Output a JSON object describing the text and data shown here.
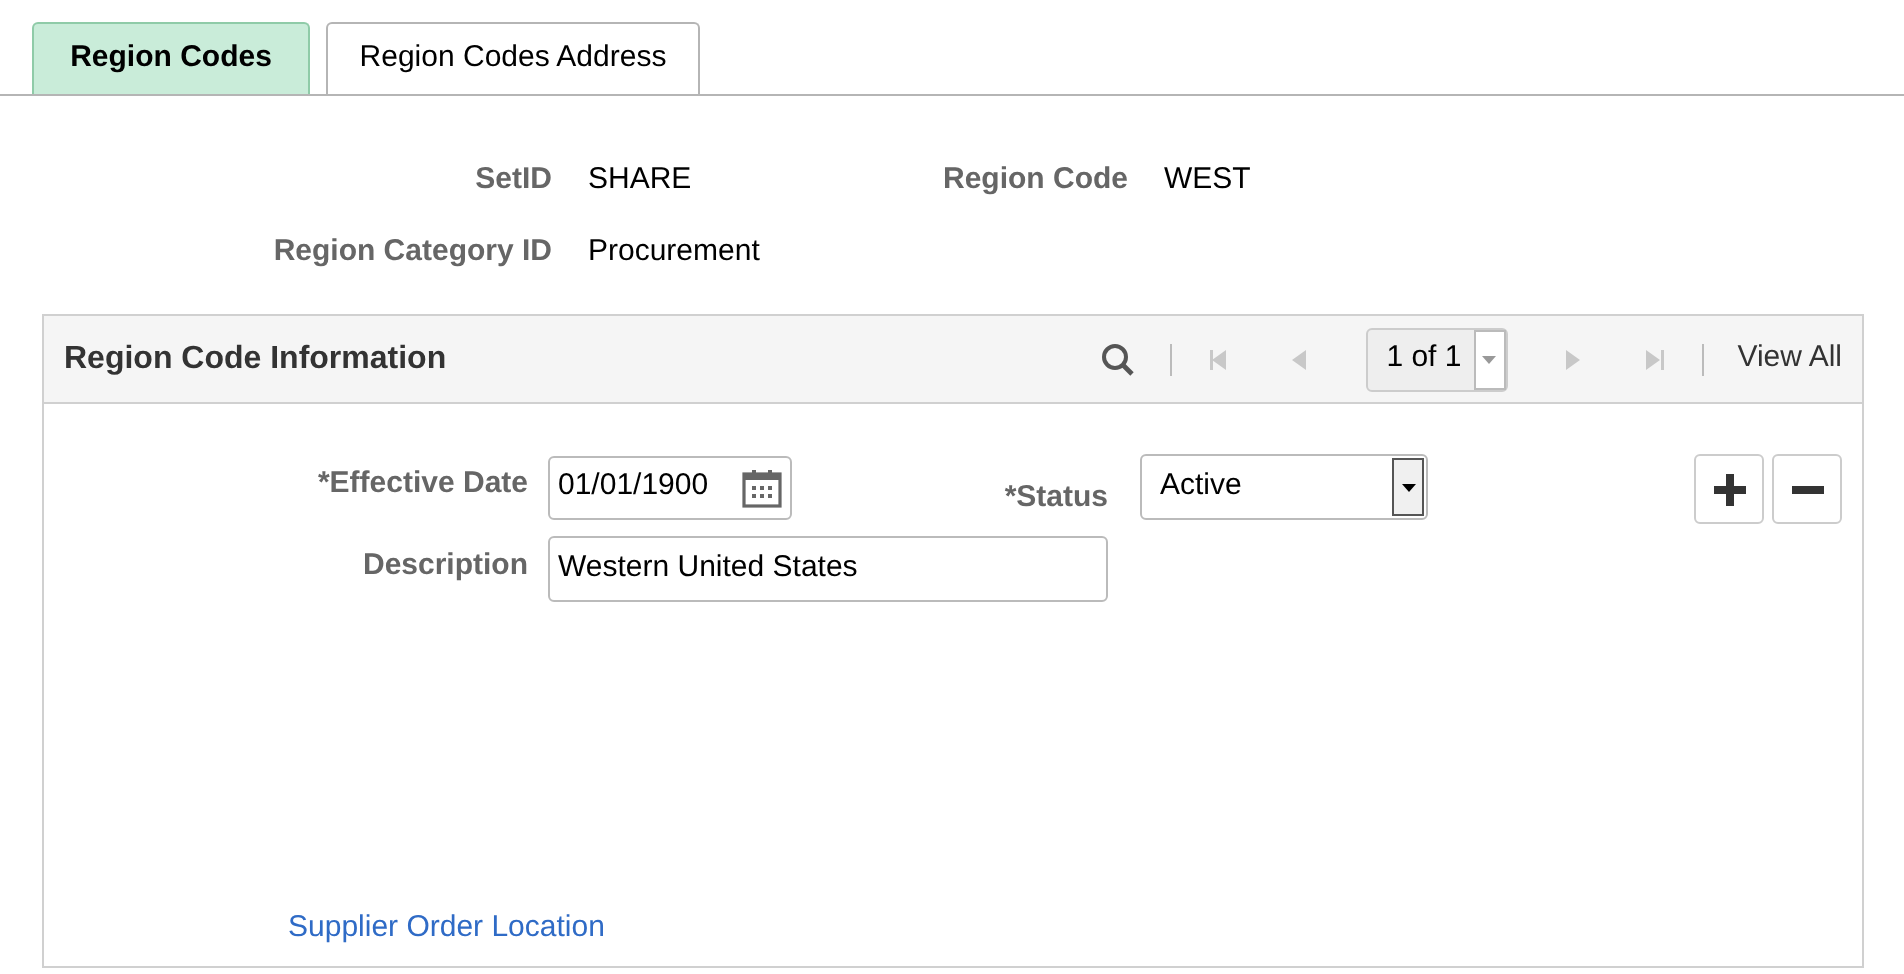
{
  "tabs": [
    {
      "label": "Region Codes",
      "selected": true
    },
    {
      "label": "Region Codes Address",
      "selected": false
    }
  ],
  "header_fields": [
    {
      "label": "SetID",
      "value": "SHARE"
    },
    {
      "label": "Region Code",
      "value": "WEST"
    },
    {
      "label": "Region Category ID",
      "value": "Procurement"
    }
  ],
  "panel": {
    "title": "Region Code Information",
    "nav": [
      {
        "kind": "first",
        "disabled": true
      },
      {
        "kind": "prev",
        "disabled": true
      },
      {
        "kind": "next",
        "disabled": true
      },
      {
        "kind": "last",
        "disabled": true
      }
    ],
    "page_counter": "1 of 1",
    "view_all": "View All",
    "effective_date": {
      "label": "*Effective Date",
      "value": "01/01/1900"
    },
    "status": {
      "label": "*Status",
      "value": "Active"
    },
    "description": {
      "label": "Description",
      "value": "Western United States"
    },
    "link": "Supplier Order Location"
  }
}
